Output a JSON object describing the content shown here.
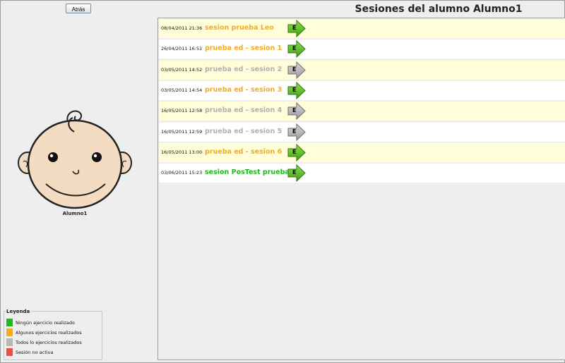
{
  "back_button": "Atrás",
  "title": "Sesiones del alumno Alumno1",
  "student_name": "Alumno1",
  "colors": {
    "orange": "#f4ab22",
    "gray": "#b0b0b0",
    "green": "#1fb81f",
    "red": "#f24b4b",
    "row_odd": "#fffed9",
    "row_even": "#ffffff"
  },
  "sessions": [
    {
      "date": "08/04/2011 21:36",
      "name": "sesion prueba Leo",
      "status": "orange",
      "arrow": "green",
      "button_label": "E"
    },
    {
      "date": "26/04/2011 16:51",
      "name": "prueba ed - sesion 1",
      "status": "orange",
      "arrow": "green",
      "button_label": "E"
    },
    {
      "date": "03/05/2011 14:52",
      "name": "prueba ed - sesion 2",
      "status": "gray",
      "arrow": "gray",
      "button_label": "E"
    },
    {
      "date": "03/05/2011 14:54",
      "name": "prueba ed - sesion 3",
      "status": "orange",
      "arrow": "green",
      "button_label": "E"
    },
    {
      "date": "16/05/2011 12:58",
      "name": "prueba ed - sesion 4",
      "status": "gray",
      "arrow": "gray",
      "button_label": "E"
    },
    {
      "date": "16/05/2011 12:59",
      "name": "prueba ed - sesion 5",
      "status": "gray",
      "arrow": "gray",
      "button_label": "E"
    },
    {
      "date": "16/05/2011 13:00",
      "name": "prueba ed - sesion 6",
      "status": "orange",
      "arrow": "green",
      "button_label": "E"
    },
    {
      "date": "03/06/2011 15:23",
      "name": "sesion PosTest prueba",
      "status": "green",
      "arrow": "green",
      "button_label": "E"
    }
  ],
  "legend": {
    "title": "Leyenda",
    "items": [
      {
        "label": "Ningún ejercicio realizado",
        "color": "#1fb81f"
      },
      {
        "label": "Algunos ejercicios realizados",
        "color": "#f4ab22"
      },
      {
        "label": "Todos lo ejercicios realizados",
        "color": "#b8b8b8"
      },
      {
        "label": "Sesión no activa",
        "color": "#f24b4b"
      }
    ]
  }
}
